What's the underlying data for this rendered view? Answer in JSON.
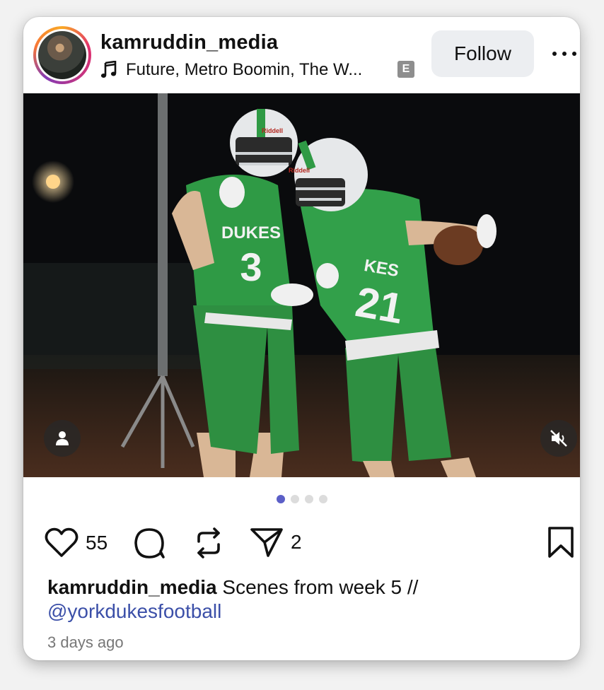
{
  "post": {
    "username": "kamruddin_media",
    "music": "Future, Metro Boomin, The W...",
    "explicit_badge": "E",
    "follow_label": "Follow",
    "likes": "55",
    "shares": "2",
    "caption_user": "kamruddin_media",
    "caption_text": " Scenes from week 5 //",
    "caption_mention": "@yorkdukesfootball",
    "time": "3 days ago",
    "carousel_total": 4,
    "carousel_active": 1
  },
  "photo": {
    "jersey_text_left": "DUKES",
    "jersey_number_left": "3",
    "jersey_text_right": "KES",
    "jersey_number_right": "21",
    "helmet_brand": "Riddell"
  },
  "icons": {
    "music": "music-note-icon",
    "like": "heart-icon",
    "comment": "comment-icon",
    "repost": "repost-icon",
    "share": "send-icon",
    "save": "bookmark-icon",
    "tag": "person-icon",
    "mute": "speaker-muted-icon",
    "more": "more-dots-icon"
  },
  "colors": {
    "accent": "#5b5fc7",
    "mention": "#3b4fa8",
    "uniform_green": "#2f9a45",
    "follow_bg": "#eceef1"
  }
}
